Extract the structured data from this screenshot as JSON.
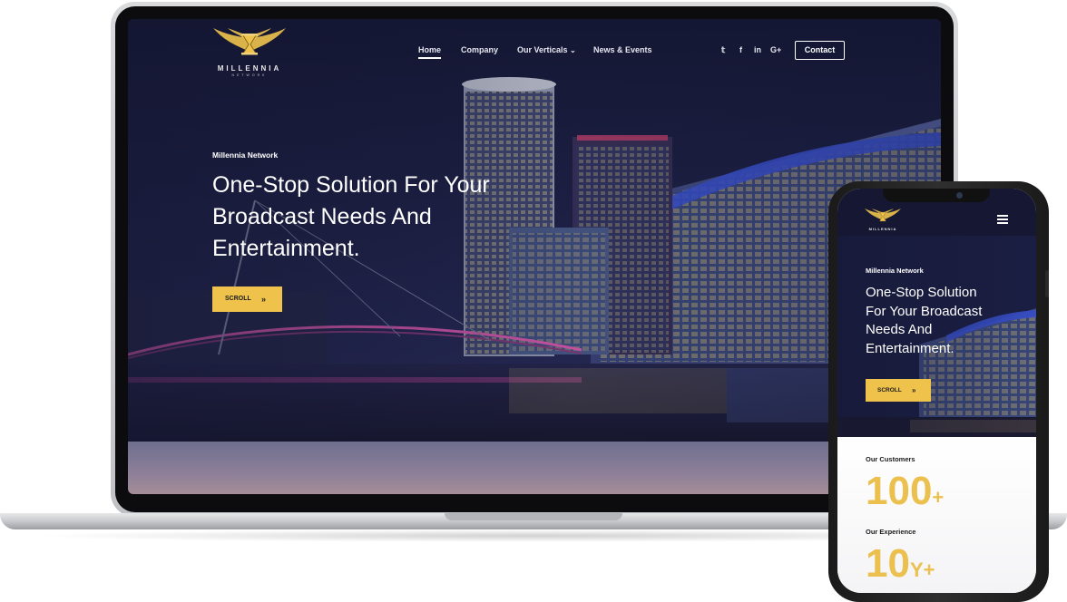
{
  "brand": {
    "name": "MILLENNIA",
    "sub": "NETWORK",
    "gold": "#efc24c"
  },
  "desktop": {
    "nav": {
      "items": [
        {
          "label": "Home",
          "active": true
        },
        {
          "label": "Company"
        },
        {
          "label": "Our Verticals",
          "has_dropdown": true
        },
        {
          "label": "News & Events"
        }
      ],
      "dropdown_icon": "chevron-down-icon",
      "social": [
        "twitter-icon",
        "facebook-icon",
        "linkedin-icon",
        "google-plus-icon"
      ],
      "social_glyphs": [
        "𝕥",
        "f",
        "in",
        "G+"
      ],
      "contact_label": "Contact"
    },
    "hero": {
      "eyebrow": "Millennia Network",
      "title_lines": [
        "One-Stop Solution For Your",
        "Broadcast Needs And",
        "Entertainment."
      ],
      "scroll_label": "SCROLL",
      "scroll_icon": "double-chevron-down-icon"
    }
  },
  "mobile": {
    "hero": {
      "eyebrow": "Millennia Network",
      "title_lines": [
        "One-Stop Solution",
        "For Your Broadcast",
        "Needs And",
        "Entertainment."
      ],
      "scroll_label": "SCROLL"
    },
    "stats": [
      {
        "label": "Our Customers",
        "value": "100",
        "suffix": "+"
      },
      {
        "label": "Our Experience",
        "value": "10",
        "suffix": "Y+"
      }
    ]
  }
}
